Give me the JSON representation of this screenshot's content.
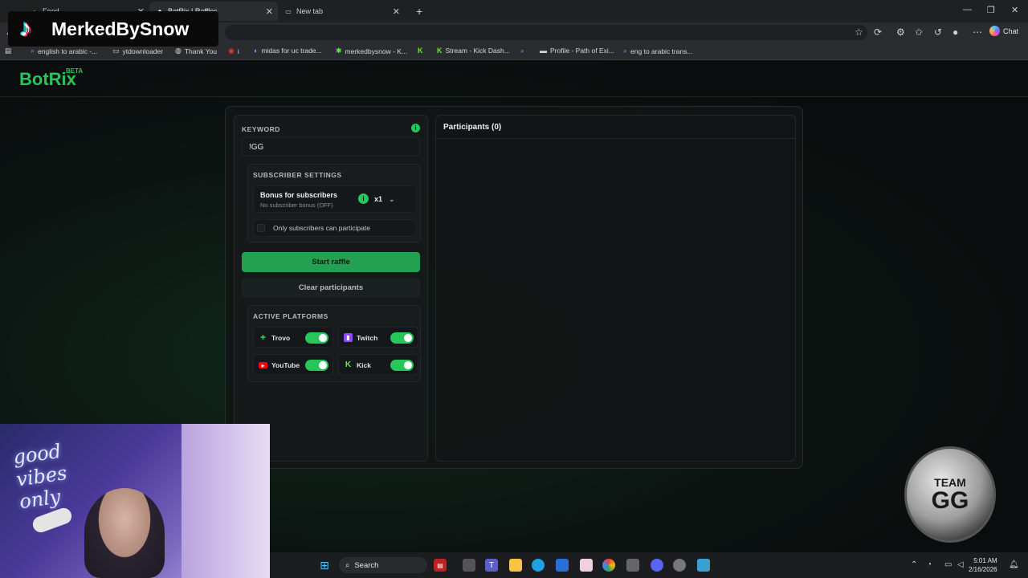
{
  "browser": {
    "tabs": [
      {
        "label": "Feed",
        "active": false
      },
      {
        "label": "BotRix | Raffles",
        "active": true
      },
      {
        "label": "New tab",
        "active": false
      }
    ],
    "new_tab_symbol": "+",
    "chat_label": "Chat",
    "bookmarks": [
      {
        "label": "english to arabic -..."
      },
      {
        "label": "ytdownloader"
      },
      {
        "label": "Thank You"
      },
      {
        "label": "i"
      },
      {
        "label": "midas for uc trade..."
      },
      {
        "label": "merkedbysnow - K..."
      },
      {
        "label": ""
      },
      {
        "label": "Stream - Kick Dash..."
      },
      {
        "label": ""
      },
      {
        "label": "Profile - Path of Exi..."
      },
      {
        "label": "eng to arabic trans..."
      }
    ]
  },
  "app": {
    "brand": "BotRix",
    "brand_tag": "BETA",
    "accent_color": "#26c65b"
  },
  "raffle": {
    "keyword_label": "KEYWORD",
    "keyword_value": "!GG",
    "subscriber_settings_title": "SUBSCRIBER SETTINGS",
    "bonus_title": "Bonus for subscribers",
    "bonus_subtitle": "No subscriber bonus (OFF)",
    "bonus_multiplier": "x1",
    "only_subs_label": "Only subscribers can participate",
    "only_subs_checked": false,
    "start_button": "Start raffle",
    "clear_button": "Clear participants",
    "platforms_title": "ACTIVE PLATFORMS",
    "platforms": [
      {
        "name": "Trovo",
        "enabled": true,
        "icon": "trovo-icon",
        "color": "#19d66b"
      },
      {
        "name": "Twitch",
        "enabled": true,
        "icon": "twitch-icon",
        "color": "#9146ff"
      },
      {
        "name": "YouTube",
        "enabled": true,
        "icon": "youtube-icon",
        "color": "#ff0000"
      },
      {
        "name": "Kick",
        "enabled": true,
        "icon": "kick-icon",
        "color": "#53fc18"
      }
    ]
  },
  "participants": {
    "title": "Participants (0)"
  },
  "overlay": {
    "tiktok_name": "MerkedBySnow",
    "webcam_sign": "good vibes only",
    "badge_top": "TEAM",
    "badge_main": "GG"
  },
  "taskbar": {
    "search_label": "Search",
    "time": "5:01 AM",
    "date": "2/16/2026"
  }
}
